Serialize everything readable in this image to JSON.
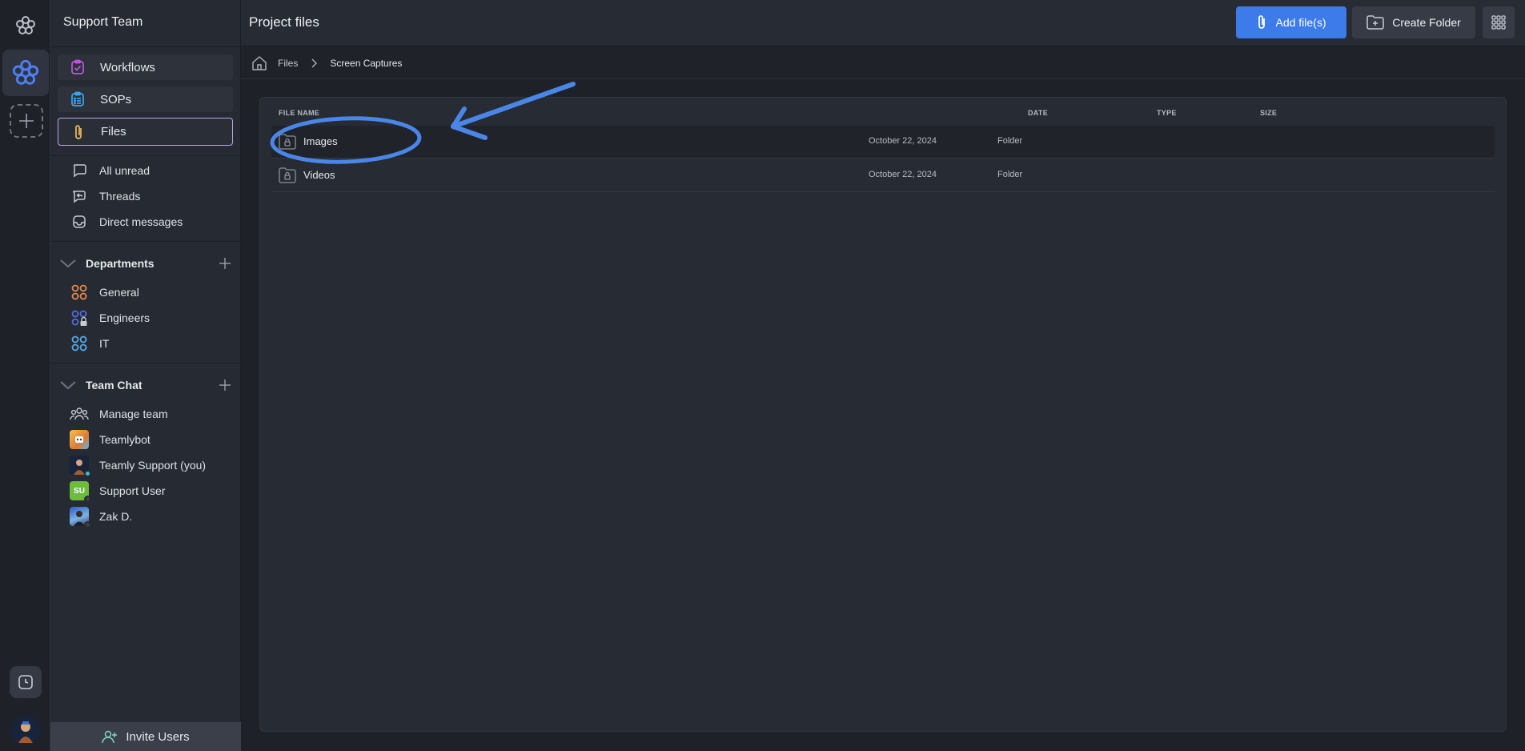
{
  "sidebar": {
    "team_name": "Support Team",
    "nav": [
      {
        "label": "Workflows",
        "icon": "workflows-icon"
      },
      {
        "label": "SOPs",
        "icon": "sops-icon"
      },
      {
        "label": "Files",
        "icon": "paperclip-icon",
        "active": true
      }
    ],
    "quick_links": [
      {
        "label": "All unread",
        "icon": "chat-bubble-icon"
      },
      {
        "label": "Threads",
        "icon": "threads-icon"
      },
      {
        "label": "Direct messages",
        "icon": "inbox-icon"
      }
    ],
    "departments": {
      "title": "Departments",
      "items": [
        {
          "label": "General"
        },
        {
          "label": "Engineers"
        },
        {
          "label": "IT"
        }
      ]
    },
    "team_chat": {
      "title": "Team Chat",
      "items": [
        {
          "label": "Manage team"
        },
        {
          "label": "Teamlybot"
        },
        {
          "label": "Teamly Support (you)"
        },
        {
          "label": "Support User",
          "initials": "SU"
        },
        {
          "label": "Zak D."
        }
      ]
    },
    "invite_label": "Invite Users"
  },
  "header": {
    "title": "Project files",
    "add_files_label": "Add file(s)",
    "create_folder_label": "Create Folder"
  },
  "breadcrumb": {
    "items": [
      "Files",
      "Screen Captures"
    ]
  },
  "table": {
    "columns": [
      "FILE NAME",
      "DATE",
      "TYPE",
      "SIZE"
    ],
    "rows": [
      {
        "name": "Images",
        "date": "October 22, 2024",
        "type": "Folder",
        "size": ""
      },
      {
        "name": "Videos",
        "date": "October 22, 2024",
        "type": "Folder",
        "size": ""
      }
    ]
  },
  "colors": {
    "accent_blue": "#3d7bea",
    "active_border": "#b7a6ec",
    "annotation": "#4a86e8"
  }
}
